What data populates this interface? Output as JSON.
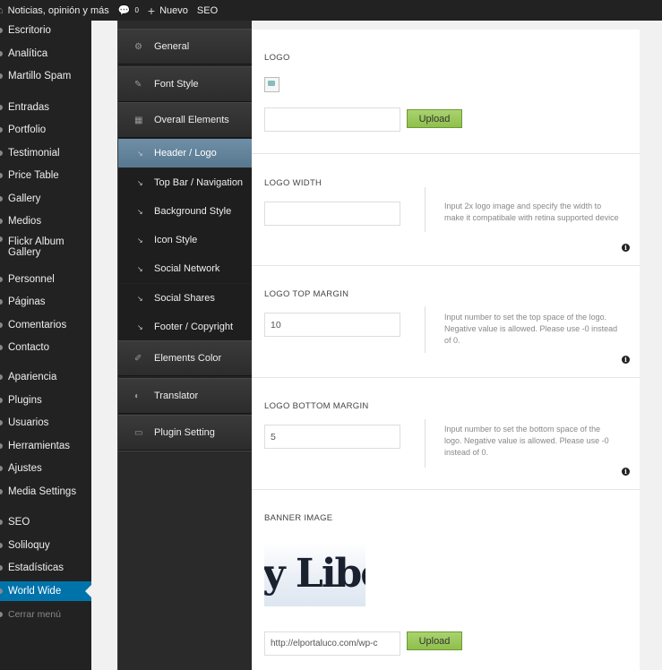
{
  "admin_bar": {
    "site_name": "Noticias, opinión y más",
    "comments_count": "0",
    "new_label": "Nuevo",
    "seo_label": "SEO"
  },
  "wp_menu": [
    {
      "label": "Escritorio"
    },
    {
      "label": "Analítica"
    },
    {
      "label": "Martillo Spam"
    },
    {
      "label": "Entradas"
    },
    {
      "label": "Portfolio"
    },
    {
      "label": "Testimonial"
    },
    {
      "label": "Price Table"
    },
    {
      "label": "Gallery"
    },
    {
      "label": "Medios"
    },
    {
      "label": "Flickr Album Gallery"
    },
    {
      "label": "Personnel"
    },
    {
      "label": "Páginas"
    },
    {
      "label": "Comentarios"
    },
    {
      "label": "Contacto"
    },
    {
      "label": "Apariencia"
    },
    {
      "label": "Plugins"
    },
    {
      "label": "Usuarios"
    },
    {
      "label": "Herramientas"
    },
    {
      "label": "Ajustes"
    },
    {
      "label": "Media Settings"
    },
    {
      "label": "SEO"
    },
    {
      "label": "Soliloquy"
    },
    {
      "label": "Estadísticas"
    },
    {
      "label": "World Wide"
    },
    {
      "label": "Cerrar menú"
    }
  ],
  "options_nav": {
    "general": "General",
    "font_style": "Font Style",
    "overall_elements": "Overall Elements",
    "sub_items": [
      {
        "label": "Header / Logo"
      },
      {
        "label": "Top Bar / Navigation"
      },
      {
        "label": "Background Style"
      },
      {
        "label": "Icon Style"
      },
      {
        "label": "Social Network"
      },
      {
        "label": "Social Shares"
      },
      {
        "label": "Footer / Copyright"
      }
    ],
    "elements_color": "Elements Color",
    "translator": "Translator",
    "plugin_setting": "Plugin Setting"
  },
  "content": {
    "logo": {
      "title": "LOGO",
      "value": "",
      "upload_label": "Upload"
    },
    "logo_width": {
      "title": "LOGO WIDTH",
      "value": "",
      "description": "Input 2x logo image and specify the width to make it compatibale with retina supported device"
    },
    "logo_top_margin": {
      "title": "LOGO TOP MARGIN",
      "value": "10",
      "description": "Input number to set the top space of the logo. Negative value is allowed. Please use -0 instead of 0."
    },
    "logo_bottom_margin": {
      "title": "LOGO BOTTOM MARGIN",
      "value": "5",
      "description": "Input number to set the bottom space of the logo. Negative value is allowed. Please use -0 instead of 0."
    },
    "banner_image": {
      "title": "BANNER IMAGE",
      "image_text": "y Libe",
      "url": "http://elportaluco.com/wp-c",
      "upload_label": "Upload"
    }
  },
  "colors": {
    "active_menu": "#0073aa",
    "active_sub": "#6e8fa7",
    "upload_button": "#8fbf4c"
  }
}
